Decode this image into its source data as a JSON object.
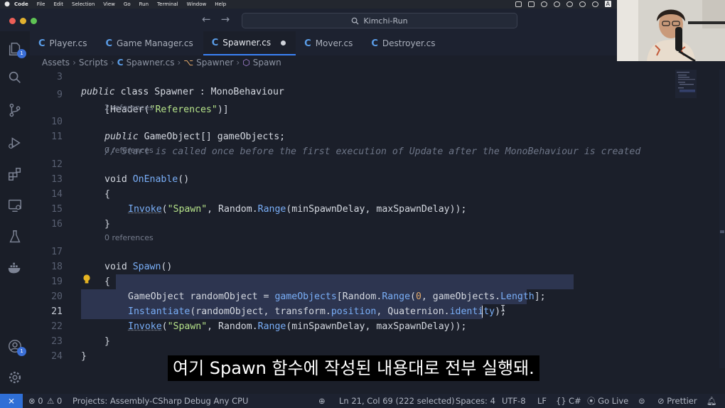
{
  "menubar": {
    "app": "Code",
    "items": [
      "File",
      "Edit",
      "Selection",
      "View",
      "Go",
      "Run",
      "Terminal",
      "Window",
      "Help"
    ],
    "tray_label": "A"
  },
  "titlebar": {
    "search_text": "Kimchi-Run",
    "back": "←",
    "forward": "→"
  },
  "tabs": [
    {
      "label": "Player.cs",
      "active": false
    },
    {
      "label": "Game Manager.cs",
      "active": false
    },
    {
      "label": "Spawner.cs",
      "active": true,
      "modified": true
    },
    {
      "label": "Mover.cs",
      "active": false
    },
    {
      "label": "Destroyer.cs",
      "active": false
    }
  ],
  "breadcrumbs": [
    "Assets",
    "Scripts",
    "Spawner.cs",
    "Spawner",
    "Spawn"
  ],
  "activity": {
    "extensions_badge": "1",
    "accounts_badge": "1"
  },
  "code": {
    "ln3": "3",
    "ln9": "9",
    "ln10": "10",
    "ln11": "11",
    "ln12": "12",
    "ln13": "13",
    "ln14": "14",
    "ln15": "15",
    "ln16": "16",
    "ln17": "17",
    "ln18": "18",
    "ln19": "19",
    "ln20": "20",
    "ln21": "21",
    "ln22": "22",
    "ln23": "23",
    "ln24": "24",
    "lens_2refs": "2 references",
    "lens_0refs_a": "0 references",
    "lens_0refs_b": "0 references",
    "l3_public": "public",
    "l3_class": "class",
    "l3_name": "Spawner : MonoBehaviour",
    "l9_header": "[Header(",
    "l9_str": "\"References\"",
    "l9_end": ")]",
    "l10_public": "public",
    "l10_rest": "GameObject[] gameObjects;",
    "l11_comment": "// Start is called once before the first execution of Update after the MonoBehaviour is created",
    "l12_void": "void",
    "l12_fn": "OnEnable",
    "l12_end": "()",
    "brace_open": "{",
    "brace_close": "}",
    "class_close": "}",
    "l14_invoke": "Invoke",
    "l14_p1": "(",
    "l14_str": "\"Spawn\"",
    "l14_p2": ", Random.",
    "l14_range": "Range",
    "l14_p3": "(minSpawnDelay, maxSpawnDelay));",
    "l17_void": "void",
    "l17_fn": "Spawn",
    "l17_end": "()",
    "l19_a": "GameObject randomObject = ",
    "l19_go": "gameObjects",
    "l19_b": "[Random.",
    "l19_range": "Range",
    "l19_c": "(",
    "l19_zero": "0",
    "l19_d": ", gameObjects.",
    "l19_len": "Length",
    "l19_e": "];",
    "l20_inst": "Instantiate",
    "l20_a": "(randomObject, transform.",
    "l20_pos": "position",
    "l20_b": ", Quaternion.",
    "l20_id": "identity",
    "l20_c": ");",
    "l21_invoke": "Invoke",
    "l21_p1": "(",
    "l21_str": "\"Spawn\"",
    "l21_p2": ", Random.",
    "l21_range": "Range",
    "l21_p3": "(minSpawnDelay, maxSpawnDelay));"
  },
  "subtitle": "여기 Spawn 함수에 작성된 내용대로 전부 실행돼.",
  "statusbar": {
    "errors": "0",
    "warnings": "0",
    "project": "Projects: Assembly-CSharp",
    "debug": "Debug Any CPU",
    "position": "Ln 21, Col 69 (222 selected)",
    "spaces": "Spaces: 4",
    "encoding": "UTF-8",
    "eol": "LF",
    "language": "C#",
    "golive": "Go Live",
    "prettier": "Prettier"
  },
  "colors": {
    "accent": "#3b82f6",
    "traffic_red": "#ec5f57",
    "traffic_yellow": "#e1b12f",
    "traffic_green": "#5fc454"
  }
}
